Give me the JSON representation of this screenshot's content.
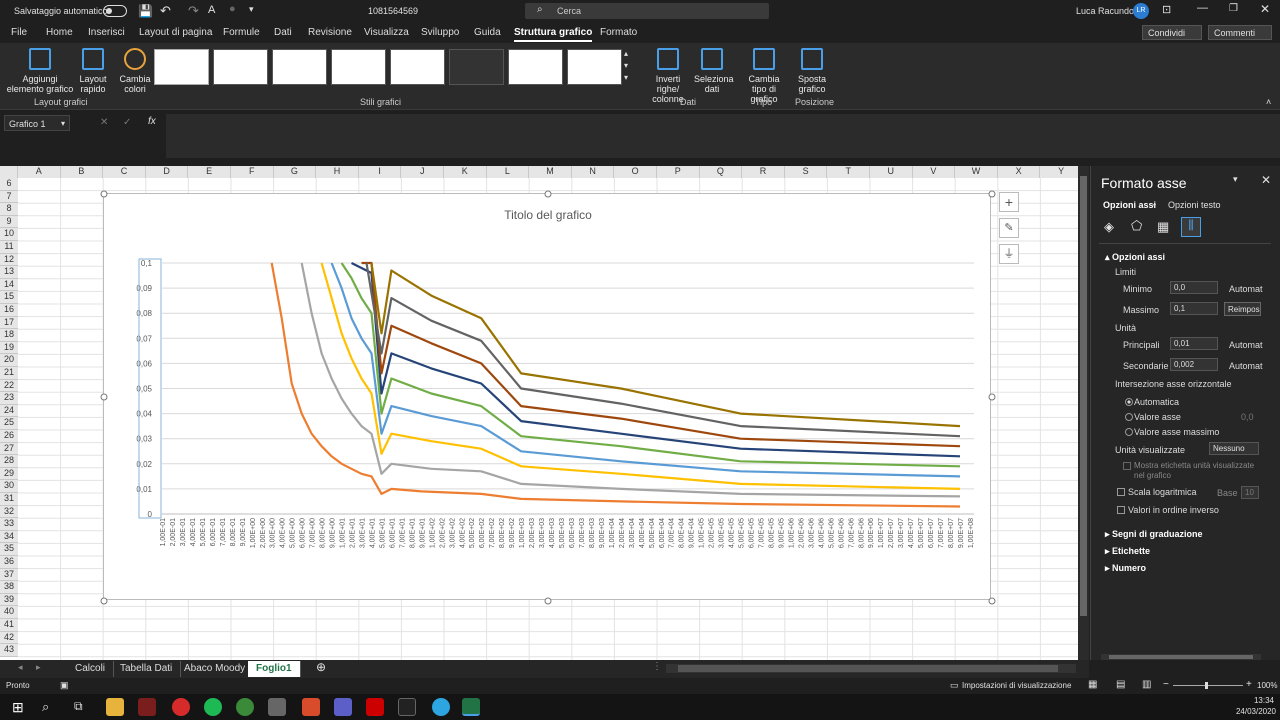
{
  "titlebar": {
    "autosave_label": "Salvataggio automatico",
    "doc_title": "1081564569",
    "search_placeholder": "Cerca",
    "user_name": "Luca Racundo",
    "user_initials": "LR"
  },
  "ribbon_tabs": [
    "File",
    "Home",
    "Inserisci",
    "Layout di pagina",
    "Formule",
    "Dati",
    "Revisione",
    "Visualizza",
    "Sviluppo",
    "Guida",
    "Struttura grafico",
    "Formato"
  ],
  "share": {
    "share_label": "Condividi",
    "comments_label": "Commenti"
  },
  "ribbon": {
    "add_element": "Aggiungi elemento grafico",
    "quick_layout": "Layout rapido",
    "change_colors": "Cambia colori",
    "group_layout": "Layout grafici",
    "group_styles": "Stili grafici",
    "switch_rows": "Inverti righe/ colonne",
    "select_data": "Seleziona dati",
    "group_data": "Dati",
    "change_type": "Cambia tipo di grafico",
    "group_type": "Tipo",
    "move_chart": "Sposta grafico",
    "group_position": "Posizione"
  },
  "formula_bar": {
    "name_box": "Grafico 1",
    "fx": "fx",
    "cancel": "✕",
    "enter": "✓"
  },
  "columns": [
    "A",
    "B",
    "C",
    "D",
    "E",
    "F",
    "G",
    "H",
    "I",
    "J",
    "K",
    "L",
    "M",
    "N",
    "O",
    "P",
    "Q",
    "R",
    "S",
    "T",
    "U",
    "V",
    "W",
    "X",
    "Y"
  ],
  "rows": [
    "6",
    "7",
    "8",
    "9",
    "10",
    "11",
    "12",
    "13",
    "14",
    "15",
    "16",
    "17",
    "18",
    "19",
    "20",
    "21",
    "22",
    "23",
    "24",
    "25",
    "26",
    "27",
    "28",
    "29",
    "30",
    "31",
    "32",
    "33",
    "34",
    "35",
    "36",
    "37",
    "38",
    "39",
    "40",
    "41",
    "42",
    "43"
  ],
  "chart_data": {
    "type": "line",
    "title": "Titolo del grafico",
    "ylim": [
      0,
      0.1
    ],
    "y_ticks": [
      "0",
      "0,01",
      "0,02",
      "0,03",
      "0,04",
      "0,05",
      "0,06",
      "0,07",
      "0,08",
      "0,09",
      "0,1"
    ],
    "x_labels": [
      "1,00E-01",
      "2,00E-01",
      "3,00E-01",
      "4,00E-01",
      "5,00E-01",
      "6,00E-01",
      "7,00E-01",
      "8,00E-01",
      "9,00E-01",
      "1,00E+00",
      "2,00E+00",
      "3,00E+00",
      "4,00E+00",
      "5,00E+00",
      "6,00E+00",
      "7,00E+00",
      "8,00E+00",
      "9,00E+00",
      "1,00E+01",
      "2,00E+01",
      "3,00E+01",
      "4,00E+01",
      "5,00E+01",
      "6,00E+01",
      "7,00E+01",
      "8,00E+01",
      "9,00E+01",
      "1,00E+02",
      "2,00E+02",
      "3,00E+02",
      "4,00E+02",
      "5,00E+02",
      "6,00E+02",
      "7,00E+02",
      "8,00E+02",
      "9,00E+02",
      "1,00E+03",
      "2,00E+03",
      "3,00E+03",
      "4,00E+03",
      "5,00E+03",
      "6,00E+03",
      "7,00E+03",
      "8,00E+03",
      "9,00E+03",
      "1,00E+04",
      "2,00E+04",
      "3,00E+04",
      "4,00E+04",
      "5,00E+04",
      "6,00E+04",
      "7,00E+04",
      "8,00E+04",
      "9,00E+04",
      "1,00E+05",
      "2,00E+05",
      "3,00E+05",
      "4,00E+05",
      "5,00E+05",
      "6,00E+05",
      "7,00E+05",
      "8,00E+05",
      "9,00E+05",
      "1,00E+06",
      "2,00E+06",
      "3,00E+06",
      "4,00E+06",
      "5,00E+06",
      "6,00E+06",
      "7,00E+06",
      "8,00E+06",
      "9,00E+06",
      "1,00E+07",
      "2,00E+07",
      "3,00E+07",
      "4,00E+07",
      "5,00E+07",
      "6,00E+07",
      "7,00E+07",
      "8,00E+07",
      "9,00E+07",
      "1,00E+08"
    ],
    "series": [
      {
        "color": "#ed7d31",
        "points": [
          [
            11,
            0.1
          ],
          [
            12,
            0.078
          ],
          [
            13,
            0.052
          ],
          [
            14,
            0.04
          ],
          [
            15,
            0.032
          ],
          [
            16,
            0.027
          ],
          [
            17,
            0.023
          ],
          [
            18,
            0.02
          ],
          [
            19,
            0.018
          ],
          [
            20,
            0.016
          ],
          [
            21,
            0.015
          ],
          [
            22,
            0.008
          ],
          [
            23,
            0.01
          ],
          [
            26,
            0.009
          ],
          [
            32,
            0.008
          ],
          [
            36,
            0.006
          ],
          [
            46,
            0.005
          ],
          [
            58,
            0.004
          ],
          [
            80,
            0.003
          ]
        ]
      },
      {
        "color": "#a5a5a5",
        "points": [
          [
            14,
            0.1
          ],
          [
            15,
            0.08
          ],
          [
            16,
            0.064
          ],
          [
            17,
            0.054
          ],
          [
            18,
            0.046
          ],
          [
            19,
            0.04
          ],
          [
            20,
            0.035
          ],
          [
            21,
            0.032
          ],
          [
            22,
            0.016
          ],
          [
            23,
            0.02
          ],
          [
            27,
            0.018
          ],
          [
            32,
            0.017
          ],
          [
            36,
            0.012
          ],
          [
            46,
            0.01
          ],
          [
            58,
            0.008
          ],
          [
            80,
            0.007
          ]
        ]
      },
      {
        "color": "#ffc000",
        "points": [
          [
            16,
            0.1
          ],
          [
            17,
            0.086
          ],
          [
            18,
            0.072
          ],
          [
            19,
            0.062
          ],
          [
            20,
            0.054
          ],
          [
            21,
            0.048
          ],
          [
            22,
            0.024
          ],
          [
            23,
            0.032
          ],
          [
            27,
            0.029
          ],
          [
            32,
            0.026
          ],
          [
            36,
            0.019
          ],
          [
            46,
            0.016
          ],
          [
            58,
            0.012
          ],
          [
            80,
            0.01
          ]
        ]
      },
      {
        "color": "#5b9bd5",
        "points": [
          [
            17,
            0.1
          ],
          [
            18,
            0.09
          ],
          [
            19,
            0.078
          ],
          [
            20,
            0.07
          ],
          [
            21,
            0.064
          ],
          [
            22,
            0.032
          ],
          [
            23,
            0.043
          ],
          [
            27,
            0.039
          ],
          [
            32,
            0.035
          ],
          [
            36,
            0.025
          ],
          [
            46,
            0.021
          ],
          [
            58,
            0.017
          ],
          [
            80,
            0.015
          ]
        ]
      },
      {
        "color": "#70ad47",
        "points": [
          [
            18,
            0.1
          ],
          [
            19,
            0.094
          ],
          [
            20,
            0.086
          ],
          [
            21,
            0.08
          ],
          [
            22,
            0.04
          ],
          [
            23,
            0.054
          ],
          [
            27,
            0.048
          ],
          [
            32,
            0.043
          ],
          [
            36,
            0.031
          ],
          [
            46,
            0.027
          ],
          [
            58,
            0.021
          ],
          [
            80,
            0.019
          ]
        ]
      },
      {
        "color": "#264478",
        "points": [
          [
            19,
            0.1
          ],
          [
            21,
            0.096
          ],
          [
            22,
            0.048
          ],
          [
            23,
            0.064
          ],
          [
            27,
            0.058
          ],
          [
            32,
            0.052
          ],
          [
            36,
            0.037
          ],
          [
            46,
            0.032
          ],
          [
            58,
            0.026
          ],
          [
            80,
            0.023
          ]
        ]
      },
      {
        "color": "#9e480e",
        "points": [
          [
            20,
            0.1
          ],
          [
            21,
            0.1
          ],
          [
            22,
            0.056
          ],
          [
            23,
            0.075
          ],
          [
            27,
            0.068
          ],
          [
            32,
            0.06
          ],
          [
            36,
            0.043
          ],
          [
            46,
            0.038
          ],
          [
            58,
            0.03
          ],
          [
            80,
            0.027
          ]
        ]
      },
      {
        "color": "#636363",
        "points": [
          [
            20.5,
            0.1
          ],
          [
            22,
            0.064
          ],
          [
            23,
            0.086
          ],
          [
            27,
            0.077
          ],
          [
            32,
            0.069
          ],
          [
            36,
            0.05
          ],
          [
            46,
            0.044
          ],
          [
            58,
            0.035
          ],
          [
            80,
            0.031
          ]
        ]
      },
      {
        "color": "#997300",
        "points": [
          [
            21,
            0.1
          ],
          [
            22,
            0.072
          ],
          [
            23,
            0.097
          ],
          [
            27,
            0.087
          ],
          [
            32,
            0.078
          ],
          [
            36,
            0.056
          ],
          [
            46,
            0.05
          ],
          [
            58,
            0.04
          ],
          [
            80,
            0.035
          ]
        ]
      }
    ]
  },
  "sheet_tabs": [
    "Calcoli",
    "Tabella Dati",
    "Abaco Moody",
    "Foglio1"
  ],
  "format_pane": {
    "title": "Formato asse",
    "opt_axis": "Opzioni assi",
    "opt_text": "Opzioni testo",
    "section": "Opzioni assi",
    "limits": "Limiti",
    "min_label": "Minimo",
    "min_value": "0,0",
    "min_mode": "Automat",
    "max_label": "Massimo",
    "max_value": "0,1",
    "max_reset": "Reimpos",
    "units": "Unità",
    "major_label": "Principali",
    "major_value": "0,01",
    "major_mode": "Automat",
    "minor_label": "Secondarie",
    "minor_value": "0,002",
    "minor_mode": "Automat",
    "crosses": "Intersezione asse orizzontale",
    "radio_auto": "Automatica",
    "radio_value": "Valore asse",
    "radio_value_field": "0,0",
    "radio_max": "Valore asse massimo",
    "display_units": "Unità visualizzate",
    "display_units_value": "Nessuno",
    "show_label": "Mostra etichetta unità visualizzate nel grafico",
    "log_scale": "Scala logaritmica",
    "base": "Base",
    "base_value": "10",
    "reverse": "Valori in ordine inverso",
    "ticks": "Segni di graduazione",
    "labels": "Etichette",
    "number": "Numero"
  },
  "status": {
    "ready": "Pronto",
    "view_settings": "Impostazioni di visualizzazione",
    "zoom": "100%"
  },
  "taskbar": {
    "time": "13:34",
    "date": "24/03/2020"
  }
}
